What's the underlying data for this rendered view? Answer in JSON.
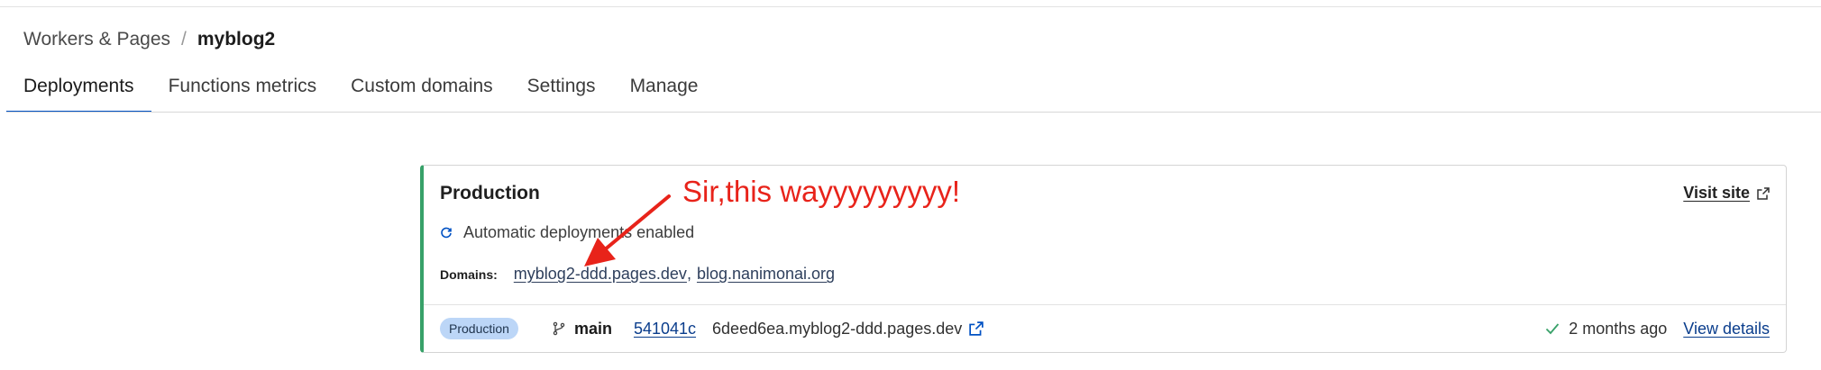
{
  "breadcrumb": {
    "parent": "Workers & Pages",
    "separator": "/",
    "current": "myblog2"
  },
  "tabs": [
    {
      "label": "Deployments",
      "active": true
    },
    {
      "label": "Functions metrics",
      "active": false
    },
    {
      "label": "Custom domains",
      "active": false
    },
    {
      "label": "Settings",
      "active": false
    },
    {
      "label": "Manage",
      "active": false
    }
  ],
  "production": {
    "title": "Production",
    "visit_site": "Visit site",
    "auto_deploy": "Automatic deployments enabled",
    "domains_label": "Domains:",
    "domains": [
      "myblog2-ddd.pages.dev",
      "blog.nanimonai.org"
    ],
    "deployment": {
      "environment": "Production",
      "branch": "main",
      "commit": "541041c",
      "url": "6deed6ea.myblog2-ddd.pages.dev",
      "time": "2 months ago",
      "view_details": "View details"
    }
  },
  "annotation": {
    "text": "Sir,this wayyyyyyyyy!",
    "color": "#e8231a"
  },
  "colors": {
    "accent": "#0051c3",
    "success": "#38a169",
    "badge_bg": "#bcd6f7"
  },
  "icons": {
    "auto_deploy": "refresh-icon",
    "external": "external-link-icon",
    "branch": "git-branch-icon",
    "check": "check-icon"
  }
}
